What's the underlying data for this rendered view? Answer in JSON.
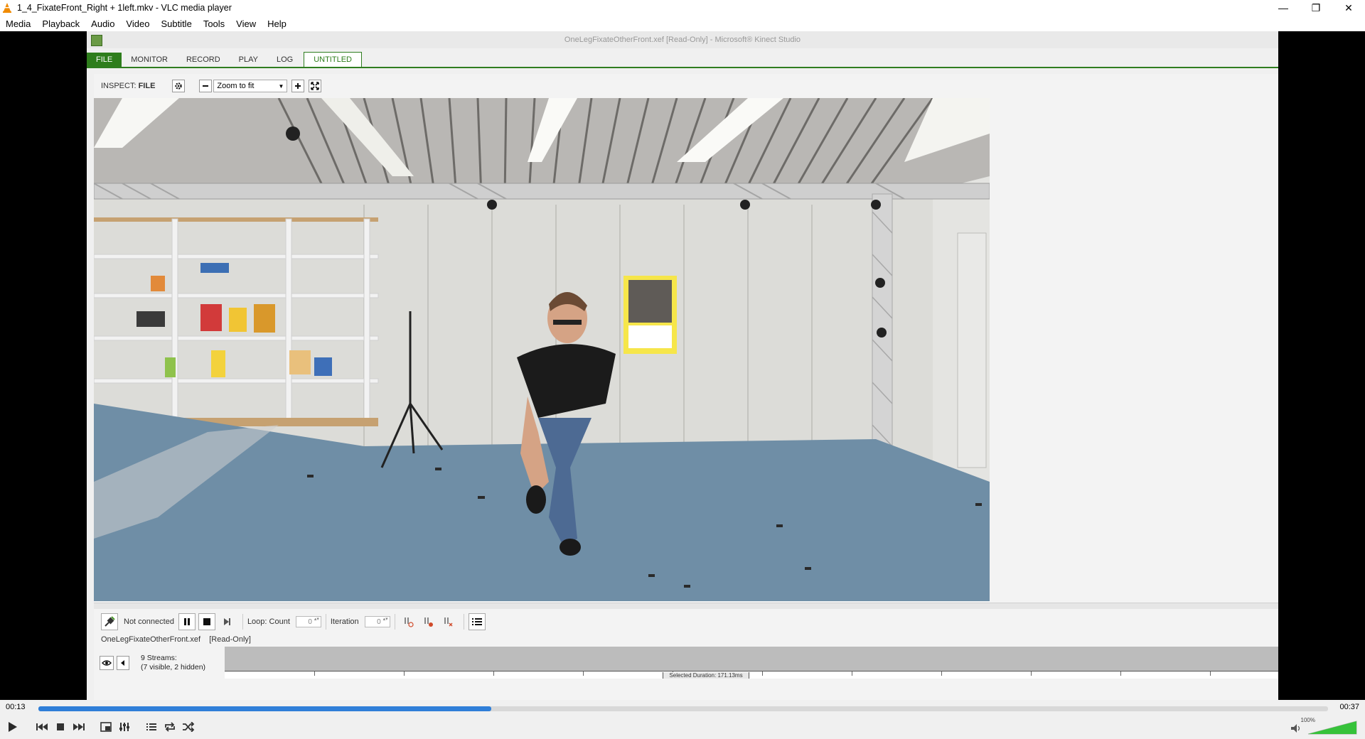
{
  "window": {
    "title": "1_4_FixateFront_Right + 1left.mkv - VLC media player",
    "minimize_glyph": "—",
    "restore_glyph": "❐",
    "close_glyph": "✕"
  },
  "menubar": {
    "items": [
      "Media",
      "Playback",
      "Audio",
      "Video",
      "Subtitle",
      "Tools",
      "View",
      "Help"
    ]
  },
  "kinect_studio": {
    "title": "OneLegFixateOtherFront.xef [Read-Only] - Microsoft® Kinect Studio",
    "tabs": [
      "FILE",
      "MONITOR",
      "RECORD",
      "PLAY",
      "LOG",
      "UNTITLED"
    ],
    "inspect_label": "INSPECT:",
    "inspect_value": "FILE",
    "zoom_value": "Zoom to fit",
    "connection_status": "Not connected",
    "loop_label": "Loop: Count",
    "loop_count": "0",
    "iteration_label": "Iteration",
    "iteration_value": "0",
    "file_name": "OneLegFixateOtherFront.xef",
    "read_only": "[Read-Only]",
    "streams_line1": "9 Streams:",
    "streams_line2": "(7 visible, 2 hidden)",
    "selected_duration": "Selected Duration: 171.13ms"
  },
  "player": {
    "time_current": "00:13",
    "time_total": "00:37",
    "progress_fraction": 0.351,
    "volume_percent": "100%",
    "volume_fraction": 1.0
  },
  "colors": {
    "accent_green": "#2e7d1c",
    "seek_blue": "#2f7ed8"
  }
}
